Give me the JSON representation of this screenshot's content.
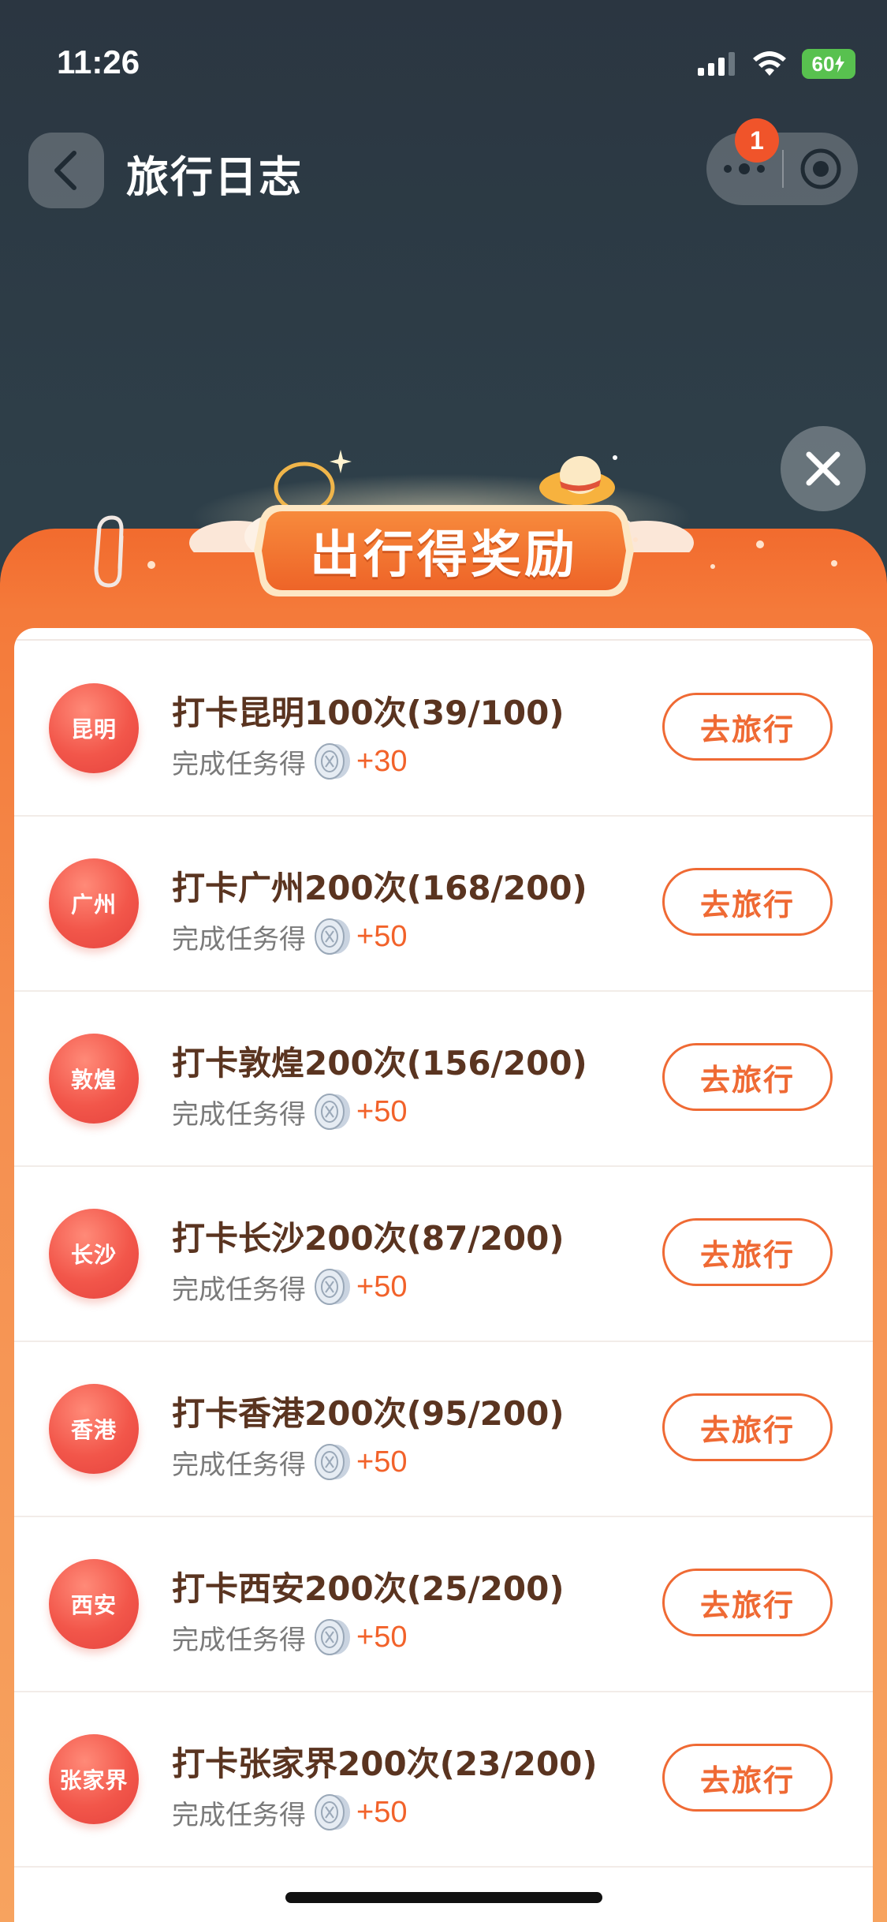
{
  "status_bar": {
    "time": "11:26",
    "battery": "60"
  },
  "nav": {
    "title": "旅行日志",
    "notification_count": "1"
  },
  "modal": {
    "header_title": "出行得奖励",
    "tasks": [
      {
        "city": "昆明",
        "title": "打卡昆明100次(39/100)",
        "sub": "完成任务得",
        "reward": "+30",
        "button": "去旅行"
      },
      {
        "city": "广州",
        "title": "打卡广州200次(168/200)",
        "sub": "完成任务得",
        "reward": "+50",
        "button": "去旅行"
      },
      {
        "city": "敦煌",
        "title": "打卡敦煌200次(156/200)",
        "sub": "完成任务得",
        "reward": "+50",
        "button": "去旅行"
      },
      {
        "city": "长沙",
        "title": "打卡长沙200次(87/200)",
        "sub": "完成任务得",
        "reward": "+50",
        "button": "去旅行"
      },
      {
        "city": "香港",
        "title": "打卡香港200次(95/200)",
        "sub": "完成任务得",
        "reward": "+50",
        "button": "去旅行"
      },
      {
        "city": "西安",
        "title": "打卡西安200次(25/200)",
        "sub": "完成任务得",
        "reward": "+50",
        "button": "去旅行"
      },
      {
        "city": "张家界",
        "title": "打卡张家界200次(23/200)",
        "sub": "完成任务得",
        "reward": "+50",
        "button": "去旅行"
      }
    ]
  },
  "colors": {
    "accent": "#ef6a34",
    "badge": "#f0542a",
    "title_text": "#5a3420"
  },
  "icons": {
    "back": "chevron-left-icon",
    "more": "more-dots-icon",
    "target": "target-icon",
    "close": "close-icon",
    "coin": "coin-stack-icon"
  }
}
